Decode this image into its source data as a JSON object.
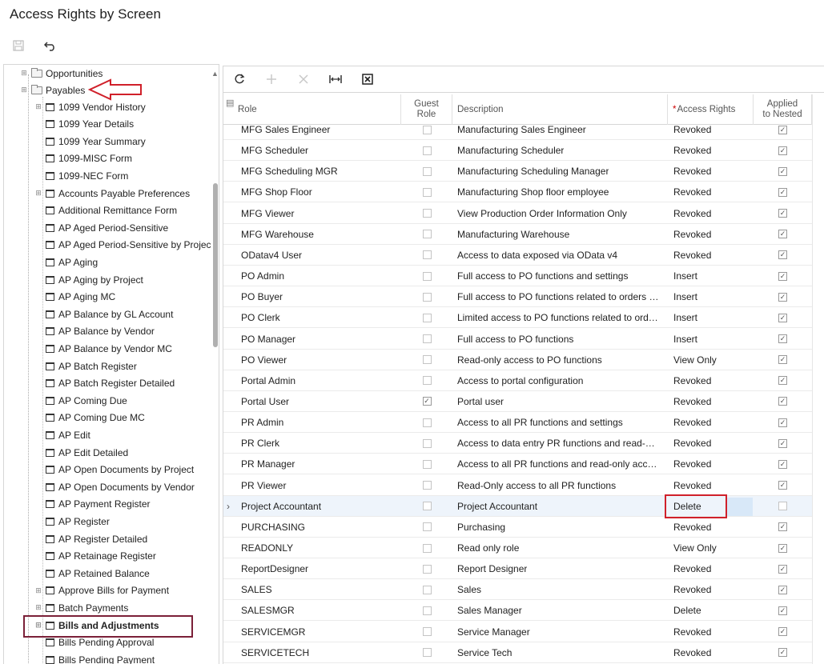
{
  "page": {
    "title": "Access Rights by Screen"
  },
  "toolbar": {
    "save_icon": "save-icon",
    "undo_icon": "undo-icon"
  },
  "tree": {
    "top_items": [
      {
        "label": "Opportunities",
        "type": "folder"
      },
      {
        "label": "Payables",
        "type": "folder"
      }
    ],
    "children": [
      {
        "label": "1099 Vendor History",
        "expandable": true
      },
      {
        "label": "1099 Year Details",
        "expandable": false
      },
      {
        "label": "1099 Year Summary",
        "expandable": false
      },
      {
        "label": "1099-MISC Form",
        "expandable": false
      },
      {
        "label": "1099-NEC Form",
        "expandable": false
      },
      {
        "label": "Accounts Payable Preferences",
        "expandable": true
      },
      {
        "label": "Additional Remittance Form",
        "expandable": false
      },
      {
        "label": "AP Aged Period-Sensitive",
        "expandable": false
      },
      {
        "label": "AP Aged Period-Sensitive by Projec",
        "expandable": false
      },
      {
        "label": "AP Aging",
        "expandable": false
      },
      {
        "label": "AP Aging by Project",
        "expandable": false
      },
      {
        "label": "AP Aging MC",
        "expandable": false
      },
      {
        "label": "AP Balance by GL Account",
        "expandable": false
      },
      {
        "label": "AP Balance by Vendor",
        "expandable": false
      },
      {
        "label": "AP Balance by Vendor MC",
        "expandable": false
      },
      {
        "label": "AP Batch Register",
        "expandable": false
      },
      {
        "label": "AP Batch Register Detailed",
        "expandable": false
      },
      {
        "label": "AP Coming Due",
        "expandable": false
      },
      {
        "label": "AP Coming Due MC",
        "expandable": false
      },
      {
        "label": "AP Edit",
        "expandable": false
      },
      {
        "label": "AP Edit Detailed",
        "expandable": false
      },
      {
        "label": "AP Open Documents by Project",
        "expandable": false
      },
      {
        "label": "AP Open Documents by Vendor",
        "expandable": false
      },
      {
        "label": "AP Payment Register",
        "expandable": false
      },
      {
        "label": "AP Register",
        "expandable": false
      },
      {
        "label": "AP Register Detailed",
        "expandable": false
      },
      {
        "label": "AP Retainage Register",
        "expandable": false
      },
      {
        "label": "AP Retained Balance",
        "expandable": false
      },
      {
        "label": "Approve Bills for Payment",
        "expandable": true
      },
      {
        "label": "Batch Payments",
        "expandable": true
      },
      {
        "label": "Bills and Adjustments",
        "expandable": true,
        "bold": true
      },
      {
        "label": "Bills Pending Approval",
        "expandable": false
      },
      {
        "label": "Bills Pending Payment",
        "expandable": false
      }
    ]
  },
  "grid": {
    "headers": {
      "role": "Role",
      "guest_line1": "Guest",
      "guest_line2": "Role",
      "description": "Description",
      "required_mark": "*",
      "access_rights": "Access Rights",
      "nested_line1": "Applied",
      "nested_line2": "to Nested"
    },
    "rows": [
      {
        "role": "MFG Sales Engineer",
        "guest": false,
        "description": "Manufacturing Sales Engineer",
        "rights": "Revoked",
        "nested": true
      },
      {
        "role": "MFG Scheduler",
        "guest": false,
        "description": "Manufacturing Scheduler",
        "rights": "Revoked",
        "nested": true
      },
      {
        "role": "MFG Scheduling MGR",
        "guest": false,
        "description": "Manufacturing Scheduling Manager",
        "rights": "Revoked",
        "nested": true
      },
      {
        "role": "MFG Shop Floor",
        "guest": false,
        "description": "Manufacturing Shop floor employee",
        "rights": "Revoked",
        "nested": true
      },
      {
        "role": "MFG Viewer",
        "guest": false,
        "description": "View Production Order Information Only",
        "rights": "Revoked",
        "nested": true
      },
      {
        "role": "MFG Warehouse",
        "guest": false,
        "description": "Manufacturing Warehouse",
        "rights": "Revoked",
        "nested": true
      },
      {
        "role": "ODatav4 User",
        "guest": false,
        "description": "Access to data exposed via OData v4",
        "rights": "Revoked",
        "nested": true
      },
      {
        "role": "PO Admin",
        "guest": false,
        "description": "Full access to PO functions and settings",
        "rights": "Insert",
        "nested": true
      },
      {
        "role": "PO Buyer",
        "guest": false,
        "description": "Full access to PO functions related to orders and receipts",
        "rights": "Insert",
        "nested": true
      },
      {
        "role": "PO Clerk",
        "guest": false,
        "description": "Limited access to PO functions related to orders",
        "rights": "Insert",
        "nested": true
      },
      {
        "role": "PO Manager",
        "guest": false,
        "description": "Full access to PO functions",
        "rights": "Insert",
        "nested": true
      },
      {
        "role": "PO Viewer",
        "guest": false,
        "description": "Read-only access to PO functions",
        "rights": "View Only",
        "nested": true
      },
      {
        "role": "Portal Admin",
        "guest": false,
        "description": "Access to portal configuration",
        "rights": "Revoked",
        "nested": true
      },
      {
        "role": "Portal User",
        "guest": true,
        "description": "Portal user",
        "rights": "Revoked",
        "nested": true
      },
      {
        "role": "PR Admin",
        "guest": false,
        "description": "Access to all PR functions and settings",
        "rights": "Revoked",
        "nested": true
      },
      {
        "role": "PR Clerk",
        "guest": false,
        "description": "Access to data entry PR functions and read-only access",
        "rights": "Revoked",
        "nested": true
      },
      {
        "role": "PR Manager",
        "guest": false,
        "description": "Access to all PR functions and read-only access to settings",
        "rights": "Revoked",
        "nested": true
      },
      {
        "role": "PR Viewer",
        "guest": false,
        "description": "Read-Only access to all PR functions",
        "rights": "Revoked",
        "nested": true
      },
      {
        "role": "Project Accountant",
        "guest": false,
        "description": "Project Accountant",
        "rights": "Delete",
        "nested": false,
        "selected": true
      },
      {
        "role": "PURCHASING",
        "guest": false,
        "description": "Purchasing",
        "rights": "Revoked",
        "nested": true
      },
      {
        "role": "READONLY",
        "guest": false,
        "description": "Read only role",
        "rights": "View Only",
        "nested": true
      },
      {
        "role": "ReportDesigner",
        "guest": false,
        "description": "Report Designer",
        "rights": "Revoked",
        "nested": true
      },
      {
        "role": "SALES",
        "guest": false,
        "description": "Sales",
        "rights": "Revoked",
        "nested": true
      },
      {
        "role": "SALESMGR",
        "guest": false,
        "description": "Sales Manager",
        "rights": "Delete",
        "nested": true
      },
      {
        "role": "SERVICEMGR",
        "guest": false,
        "description": "Service Manager",
        "rights": "Revoked",
        "nested": true
      },
      {
        "role": "SERVICETECH",
        "guest": false,
        "description": "Service Tech",
        "rights": "Revoked",
        "nested": true
      }
    ]
  }
}
